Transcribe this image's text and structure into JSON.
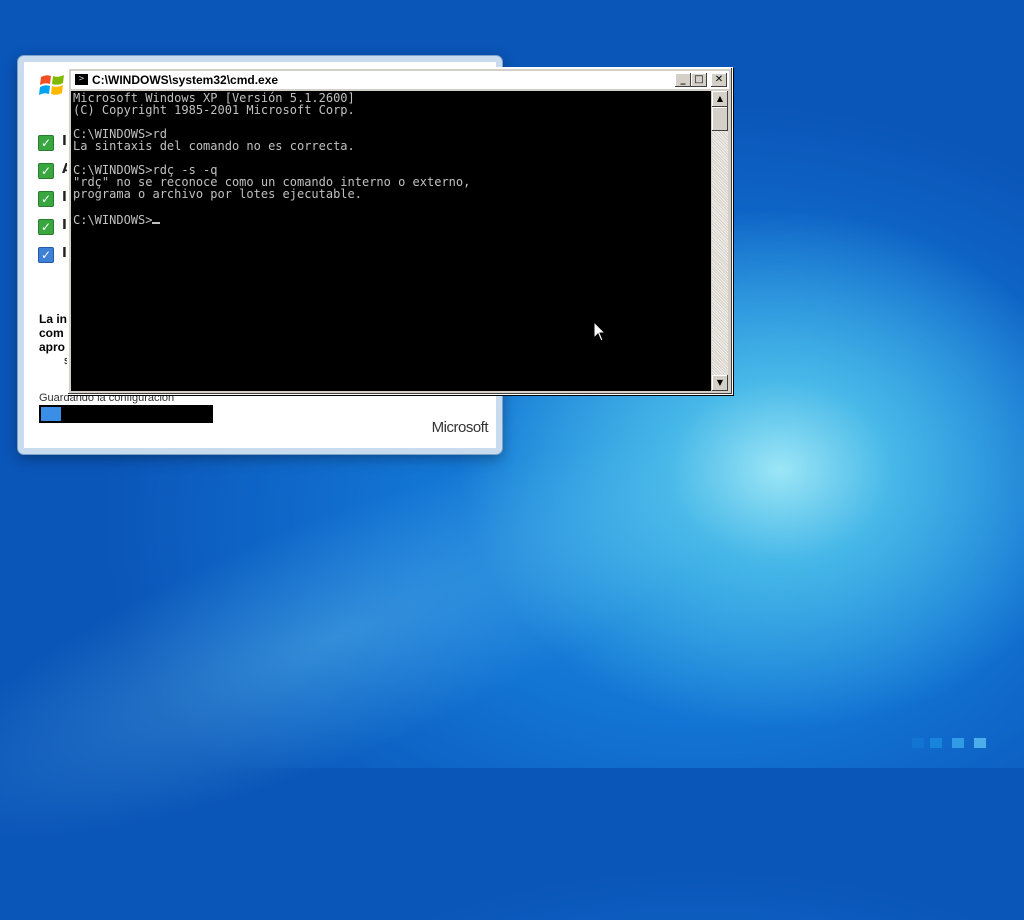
{
  "cmd": {
    "title": "C:\\WINDOWS\\system32\\cmd.exe",
    "buttons": {
      "minimize": "_",
      "maximize": "□",
      "close": "✕"
    },
    "lines": [
      "Microsoft Windows XP [Versión 5.1.2600]",
      "(C) Copyright 1985-2001 Microsoft Corp.",
      "",
      "C:\\WINDOWS>rd",
      "La sintaxis del comando no es correcta.",
      "",
      "C:\\WINDOWS>rdç -s -q",
      "\"rdç\" no se reconoce como un comando interno o externo,",
      "programa o archivo por lotes ejecutable.",
      "",
      "C:\\WINDOWS>"
    ]
  },
  "setup": {
    "partial_items": [
      "I",
      "A",
      "I",
      "I",
      "I"
    ],
    "text_lines": [
      "La in",
      "com",
      "apro",
      "s"
    ],
    "status_label": "Guardando la configuración",
    "progress": 0.12,
    "brand": "Microsoft"
  },
  "colors": {
    "console_bg": "#000000",
    "console_fg": "#c0c0c0",
    "check_green": "#3aa640",
    "check_blue": "#3d80d6",
    "progress_fill": "#3a8ee6"
  },
  "icons": {
    "cmd_icon": "cmd-icon",
    "windows_logo": "windows-logo",
    "cursor": "mouse-pointer"
  }
}
